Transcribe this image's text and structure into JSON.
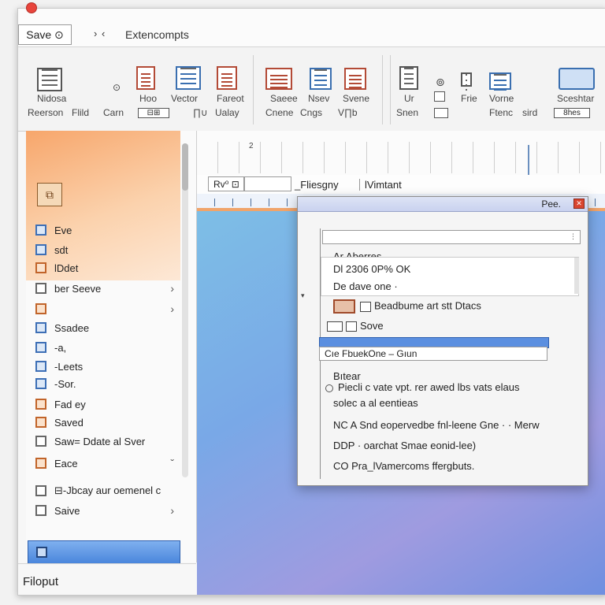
{
  "titlebar": {
    "save_label": "Save ⊙",
    "nav_forward": "›",
    "nav_back": "‹",
    "title": "Extencompts"
  },
  "ribbon": {
    "groups": [
      {
        "items": [
          {
            "label1": "Nidosa",
            "label2": "Reerson"
          },
          {
            "label1": "",
            "label2": "Flild"
          },
          {
            "label1": "",
            "label2": "Carn"
          }
        ]
      },
      {
        "items": [
          {
            "label1": "Hoo",
            "label2": ""
          },
          {
            "label1": "Vector",
            "label2": "∏∪"
          },
          {
            "label1": "Fareot",
            "label2": "Ualay"
          }
        ]
      },
      {
        "items": [
          {
            "label1": "Saeee",
            "label2": "Cnene"
          },
          {
            "label1": "Nsev",
            "label2": "Cngs"
          },
          {
            "label1": "Svene",
            "label2": "V∏b"
          }
        ]
      },
      {
        "items": [
          {
            "label1": "Ur",
            "label2": "Snen"
          },
          {
            "label1": "",
            "label2": ""
          },
          {
            "label1": "Frie",
            "label2": ""
          },
          {
            "label1": "Vorne",
            "label2": "Ftenc"
          },
          {
            "label1": "",
            "label2": "sird"
          },
          {
            "label1": "Sceshtar",
            "label2": "8hes"
          }
        ]
      }
    ],
    "hoo_box": "⊟⊞",
    "shes_box": "8hes"
  },
  "sidebar": {
    "items": [
      {
        "label": "Eve",
        "icon": "blue",
        "chevron": ""
      },
      {
        "label": "sdt",
        "icon": "blue",
        "chevron": ""
      },
      {
        "label": "lDdet",
        "icon": "orange",
        "chevron": ""
      },
      {
        "label": "ber Seeve",
        "icon": "gray",
        "chevron": "›"
      },
      {
        "label": "",
        "icon": "orange",
        "chevron": "›"
      },
      {
        "label": "Ssadee",
        "icon": "blue",
        "chevron": ""
      },
      {
        "label": "-a,",
        "icon": "blue",
        "chevron": ""
      },
      {
        "label": "-Leets",
        "icon": "blue",
        "chevron": ""
      },
      {
        "label": "-Sor.",
        "icon": "blue",
        "chevron": ""
      },
      {
        "label": "Fad ey",
        "icon": "orange",
        "chevron": ""
      },
      {
        "label": "Saved",
        "icon": "orange",
        "chevron": ""
      },
      {
        "label": "Saw= Ddate al Sver",
        "icon": "gray",
        "chevron": ""
      },
      {
        "label": "Eace",
        "icon": "orange",
        "chevron": "ˇ"
      },
      {
        "label": "⊟-Jbcay aur oemenel c",
        "icon": "gray",
        "chevron": ""
      },
      {
        "label": "Saive",
        "icon": "gray",
        "chevron": "›"
      }
    ]
  },
  "status": {
    "text": "Filoput"
  },
  "canvas": {
    "ruler_number": "2",
    "format": {
      "field1": "Rv⁰ ⊡",
      "field2": "_Fliesgny",
      "field3": "lVimtant"
    }
  },
  "dialog": {
    "title": "Pee.",
    "close": "✕",
    "rows": {
      "r1": "Ar Aberres",
      "r2": "Dl 2306 0P% OK",
      "r3": "De dave one ·",
      "r4": "Beadbume art stt Dtacs",
      "r5": "Sove",
      "combo": "Cıe  FbuekOne –  Gıun",
      "r6": "Bıtear",
      "r7": "Piecli c vate vpt. rer awed lbs vats elaus",
      "r8": "solec a al eentieas",
      "r9": "NC A Snd eopervedbe fnl-leene Gne  · ·  Merw",
      "r10": "DDP · oarchat Smae eonid-lee)",
      "r11": "CO Pra_lVamercoms ffergbuts."
    }
  }
}
